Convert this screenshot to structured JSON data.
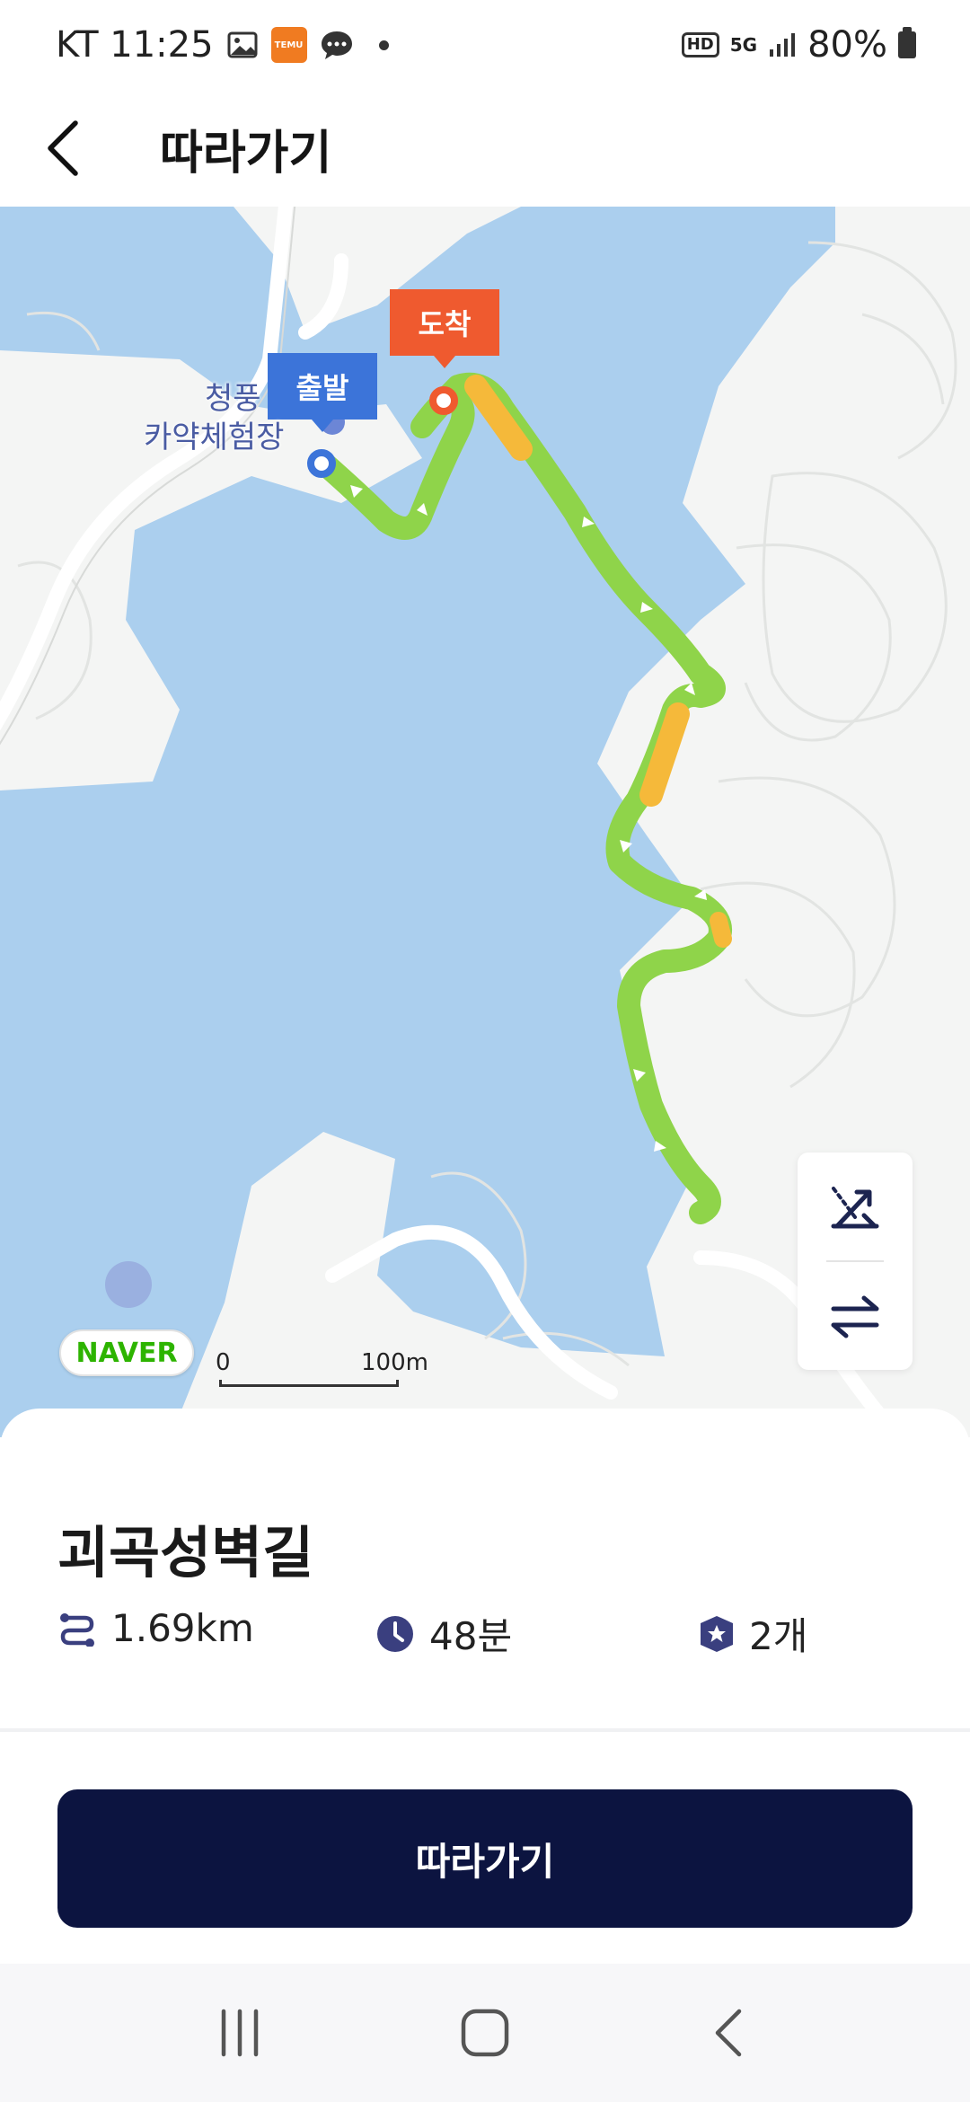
{
  "status_bar": {
    "carrier_time": "KT 11:25",
    "temu_label": "TEMU",
    "hd_label": "HD",
    "network": "5G",
    "battery": "80%"
  },
  "header": {
    "title": "따라가기",
    "back_icon": "chevron-left-icon"
  },
  "map": {
    "start_label": "출발",
    "end_label": "도착",
    "place_name_line1": "청풍",
    "place_name_line2": "카약체험장",
    "provider": "NAVER",
    "scale_start": "0",
    "scale_end": "100m",
    "controls": [
      "elevation-toggle-icon",
      "reverse-route-icon"
    ],
    "colors": {
      "water": "#abcfee",
      "land": "#f4f5f4",
      "route": "#8fd44a",
      "route_slope": "#f5b93a",
      "start_pin": "#3c74d9",
      "end_pin": "#ef5a2f"
    }
  },
  "course": {
    "name": "괴곡성벽길",
    "distance": "1.69km",
    "duration": "48분",
    "points": "2개",
    "accent_color": "#3a3f7f"
  },
  "action": {
    "follow_label": "따라가기",
    "button_color": "#0c1440"
  },
  "nav_bar": {
    "items": [
      "recent-apps-icon",
      "home-icon",
      "back-icon"
    ]
  }
}
